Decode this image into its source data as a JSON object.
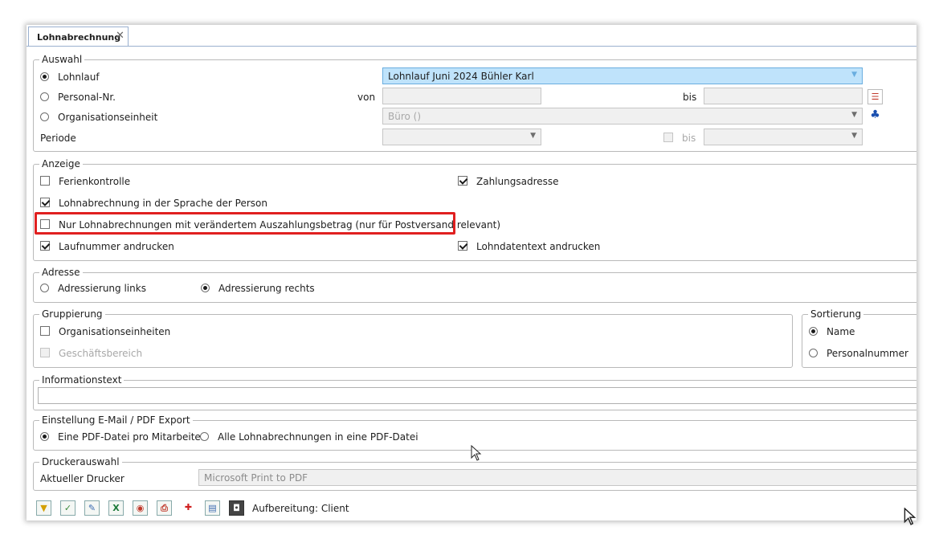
{
  "tab": {
    "title": "Lohnabrechnung",
    "close": "✕"
  },
  "auswahl": {
    "legend": "Auswahl",
    "lohnlauf": {
      "label": "Lohnlauf",
      "value": "Lohnlauf Juni 2024 Bühler Karl"
    },
    "personal": {
      "label": "Personal-Nr.",
      "von": "von",
      "bis": "bis"
    },
    "org": {
      "label": "Organisationseinheit",
      "value": "Büro ()"
    },
    "periode": {
      "label": "Periode",
      "bis": "bis"
    }
  },
  "anzeige": {
    "legend": "Anzeige",
    "ferienkontrolle": "Ferienkontrolle",
    "zahlungsadresse": "Zahlungsadresse",
    "sprache": "Lohnabrechnung in der Sprache der Person",
    "nur_veraendert": "Nur Lohnabrechnungen mit verändertem Auszahlungsbetrag (nur für Postversand relevant)",
    "laufnummer": "Laufnummer andrucken",
    "lohndatentext": "Lohndatentext andrucken"
  },
  "adresse": {
    "legend": "Adresse",
    "links": "Adressierung links",
    "rechts": "Adressierung rechts"
  },
  "gruppierung": {
    "legend": "Gruppierung",
    "org": "Organisationseinheiten",
    "geschaeft": "Geschäftsbereich"
  },
  "sortierung": {
    "legend": "Sortierung",
    "name": "Name",
    "personalnummer": "Personalnummer"
  },
  "info": {
    "legend": "Informationstext"
  },
  "export": {
    "legend": "Einstellung E-Mail / PDF Export",
    "pro_mitarbeiter": "Eine PDF-Datei pro Mitarbeiter",
    "alle": "Alle Lohnabrechnungen in eine PDF-Datei"
  },
  "drucker": {
    "legend": "Druckerauswahl",
    "label": "Aktueller Drucker",
    "value": "Microsoft Print to PDF"
  },
  "footer": {
    "aufbereitung": "Aufbereitung: Client"
  },
  "colors": {
    "selection": "#bfe3fb",
    "highlight": "#e02020"
  }
}
